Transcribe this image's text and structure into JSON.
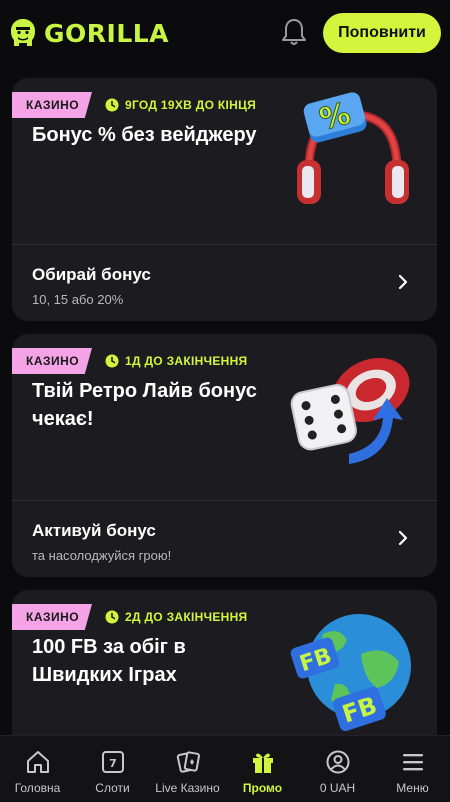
{
  "header": {
    "brand": "GORILLA",
    "topup_label": "Поповнити"
  },
  "promos": [
    {
      "tag": "КАЗИНО",
      "timer": "9ГОД 19ХВ ДО КІНЦЯ",
      "title": "Бонус % без вейджеру",
      "cta_title": "Обирай бонус",
      "cta_desc": "10, 15 або 20%",
      "art": "percent-headphones"
    },
    {
      "tag": "КАЗИНО",
      "timer": "1Д ДО ЗАКІНЧЕННЯ",
      "title": "Твій Ретро Лайв бонус чекає!",
      "cta_title": "Активуй бонус",
      "cta_desc": "та насолоджуйся грою!",
      "art": "dice-chip"
    },
    {
      "tag": "КАЗИНО",
      "timer": "2Д ДО ЗАКІНЧЕННЯ",
      "title": "100 FB за обіг в Швидких Іграх",
      "art": "fb-globe"
    }
  ],
  "nav": [
    {
      "label": "Головна",
      "icon": "home-icon"
    },
    {
      "label": "Слоти",
      "icon": "slots-icon"
    },
    {
      "label": "Live Казино",
      "icon": "cards-icon"
    },
    {
      "label": "Промо",
      "icon": "gift-icon",
      "active": true
    },
    {
      "label": "0 UAH",
      "icon": "user-icon"
    },
    {
      "label": "Меню",
      "icon": "menu-icon"
    }
  ],
  "colors": {
    "accent": "#d4f53c",
    "tag": "#f3a3e6",
    "card": "#1c1c20",
    "background": "#0b0b0d"
  }
}
